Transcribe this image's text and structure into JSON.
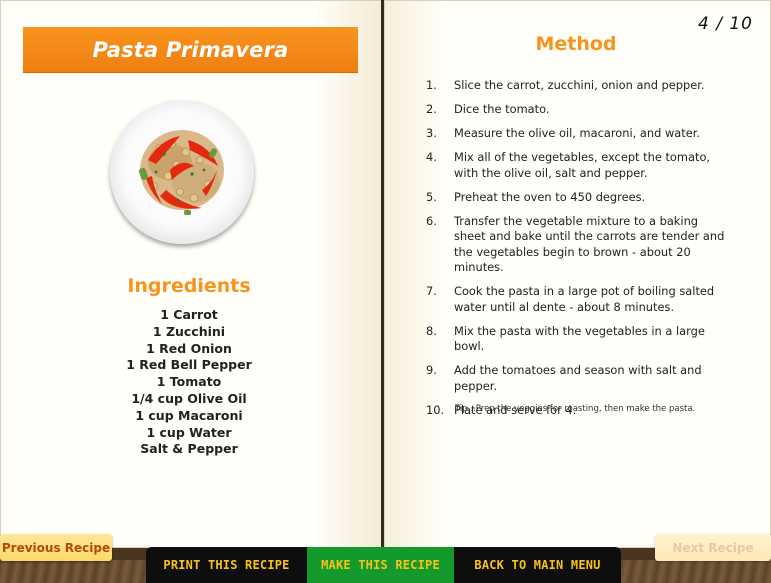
{
  "recipe": {
    "title": "Pasta Primavera",
    "page_indicator": "4 / 10",
    "ingredients_heading": "Ingredients",
    "ingredients": [
      "1 Carrot",
      "1 Zucchini",
      "1 Red Onion",
      "1 Red Bell Pepper",
      "1 Tomato",
      "1/4 cup Olive Oil",
      "1 cup Macaroni",
      "1 cup Water",
      "Salt & Pepper"
    ],
    "method_heading": "Method",
    "steps": [
      {
        "num": "1.",
        "text": "Slice the carrot, zucchini, onion and pepper."
      },
      {
        "num": "2.",
        "text": "Dice the tomato."
      },
      {
        "num": "3.",
        "text": "Measure the olive oil, macaroni, and water."
      },
      {
        "num": "4.",
        "text": "Mix all of the vegetables, except the tomato, with the olive oil, salt and pepper."
      },
      {
        "num": "5.",
        "text": "Preheat the oven to 450 degrees."
      },
      {
        "num": "6.",
        "text": "Transfer the vegetable mixture to a baking sheet and bake until the carrots are tender and the vegetables begin to brown - about 20 minutes."
      },
      {
        "num": "7.",
        "text": "Cook the pasta in a large pot of boiling salted water until al dente - about 8 minutes."
      },
      {
        "num": "8.",
        "text": "Mix the pasta with the vegetables in a large bowl."
      },
      {
        "num": "9.",
        "text": "Add the tomatoes and season with salt and pepper."
      },
      {
        "num": "10.",
        "text": "Plate and serve for 4."
      }
    ],
    "tip": "Tip...Prep the veggies for roasting, then make the pasta."
  },
  "nav": {
    "previous_label": "Previous Recipe",
    "next_label": "Next Recipe"
  },
  "actions": {
    "print_label": "PRINT THIS RECIPE",
    "make_label": "MAKE THIS RECIPE",
    "back_label": "BACK TO MAIN MENU"
  },
  "colors": {
    "accent_orange": "#f7941d",
    "action_text": "#f7c21a",
    "active_action_bg": "#13992c",
    "action_bar_bg": "#0e0e0e"
  },
  "icons": {
    "dish_image": "pasta-primavera-plate"
  }
}
